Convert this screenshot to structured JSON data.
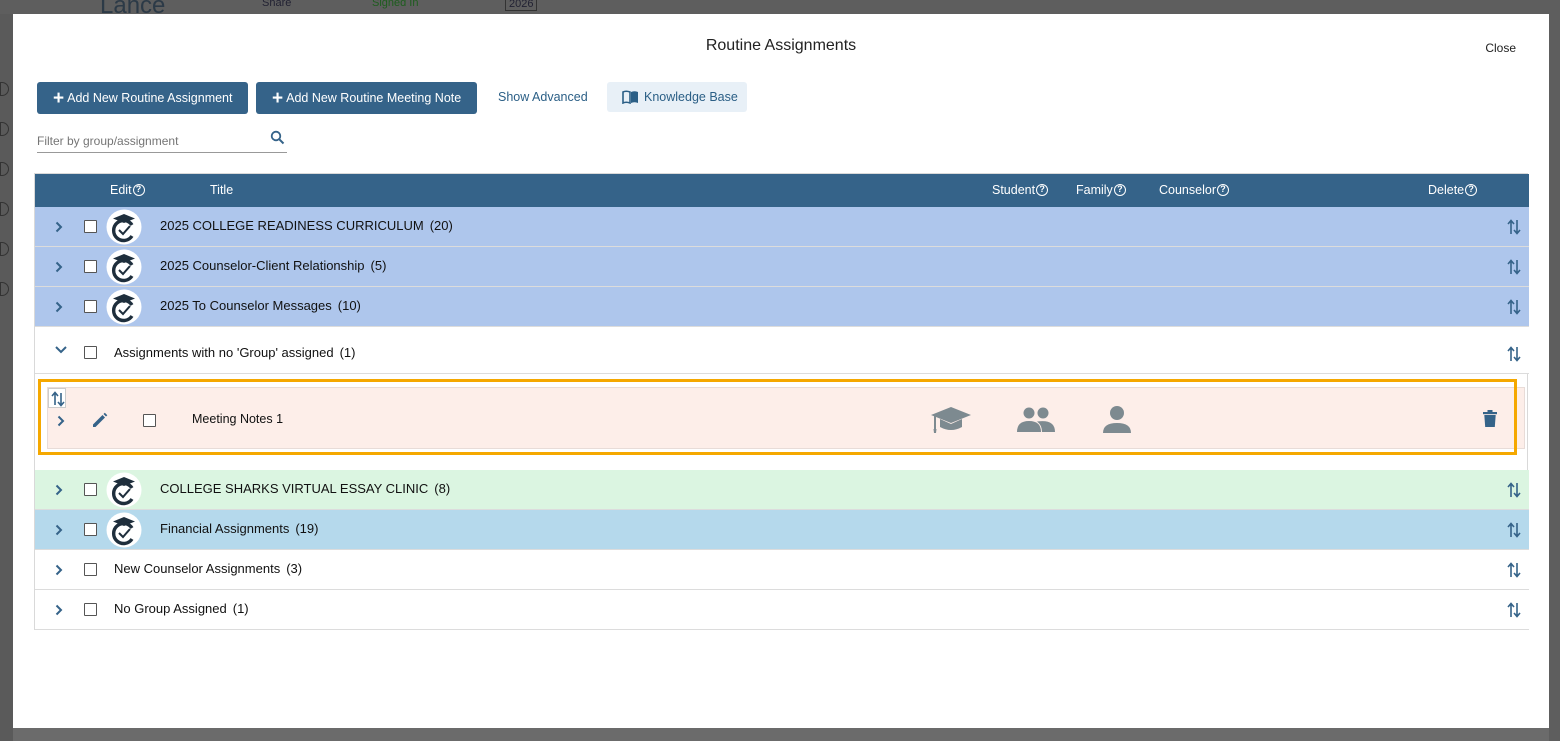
{
  "background": {
    "name": "Lance",
    "share_label": "Share",
    "signed_label": "Signed In",
    "year": "2026"
  },
  "modal": {
    "title": "Routine Assignments",
    "close_label": "Close"
  },
  "toolbar": {
    "add_assignment_label": "Add New Routine Assignment",
    "add_note_label": "Add New Routine Meeting Note",
    "show_advanced_label": "Show Advanced",
    "knowledge_base_label": "Knowledge Base"
  },
  "filter": {
    "placeholder": "Filter by group/assignment",
    "value": ""
  },
  "table": {
    "headers": {
      "edit": "Edit",
      "title": "Title",
      "student": "Student",
      "family": "Family",
      "counselor": "Counselor",
      "delete": "Delete"
    },
    "groups": [
      {
        "title": "2025 COLLEGE READINESS CURRICULUM",
        "count": "(20)",
        "has_logo": true,
        "expanded": false,
        "color": "#aec6ec"
      },
      {
        "title": "2025 Counselor-Client Relationship",
        "count": "(5)",
        "has_logo": true,
        "expanded": false,
        "color": "#aec6ec"
      },
      {
        "title": "2025 To Counselor Messages",
        "count": "(10)",
        "has_logo": true,
        "expanded": false,
        "color": "#aec6ec"
      },
      {
        "title": "Assignments with no 'Group' assigned",
        "count": "(1)",
        "has_logo": false,
        "expanded": true,
        "color": "#ffffff"
      },
      {
        "title": "COLLEGE SHARKS VIRTUAL ESSAY CLINIC",
        "count": "(8)",
        "has_logo": true,
        "expanded": false,
        "color": "#dbf5e1"
      },
      {
        "title": "Financial Assignments",
        "count": "(19)",
        "has_logo": true,
        "expanded": false,
        "color": "#b5d9ec"
      },
      {
        "title": "New Counselor Assignments",
        "count": "(3)",
        "has_logo": false,
        "expanded": false,
        "color": "#ffffff"
      },
      {
        "title": "No Group Assigned",
        "count": "(1)",
        "has_logo": false,
        "expanded": false,
        "color": "#ffffff"
      }
    ],
    "sub_item": {
      "title": "Meeting Notes 1",
      "student_icon": "graduation-cap-icon",
      "family_icon": "family-icon",
      "counselor_icon": "person-icon",
      "delete_icon": "trash-icon"
    }
  },
  "colors": {
    "primary": "#356389",
    "highlight": "#f5a800",
    "link": "#2b5f86",
    "sub_row_bg": "#fdeee9"
  }
}
